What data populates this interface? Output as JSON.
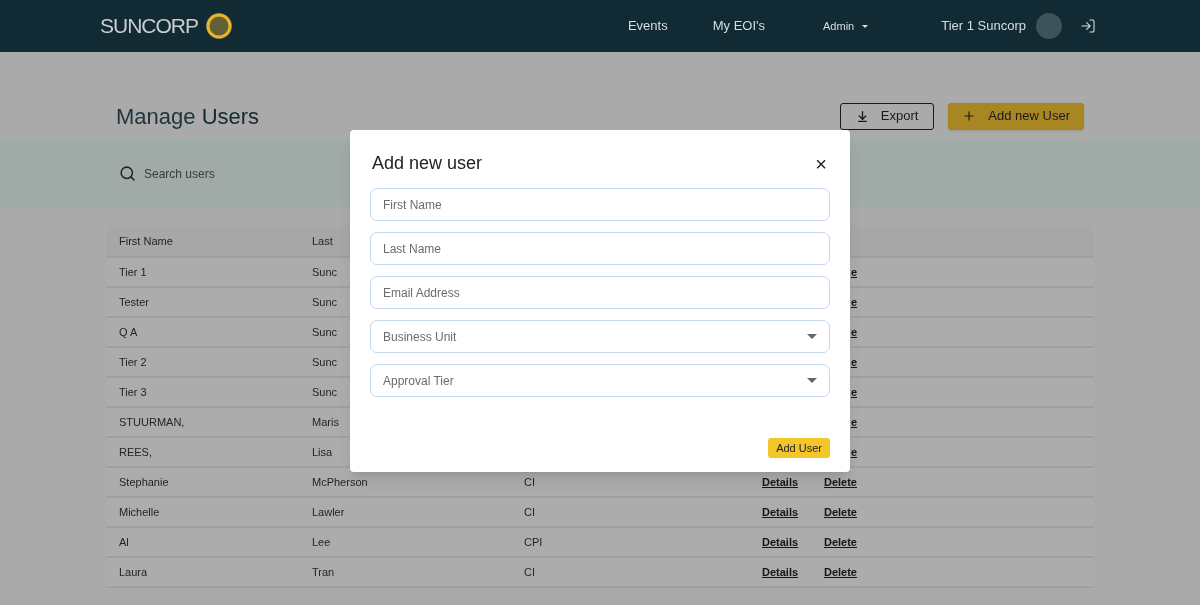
{
  "header": {
    "logo_text": "SUNCORP",
    "nav": [
      {
        "label": "Events",
        "kind": "link"
      },
      {
        "label": "My EOI's",
        "kind": "link"
      },
      {
        "label": "Admin",
        "kind": "dropdown"
      }
    ],
    "user_name": "Tier 1 Suncorp"
  },
  "page": {
    "title_light": "Manage",
    "title_bold": "Users",
    "export_button": "Export",
    "add_button": "Add new User"
  },
  "search": {
    "placeholder": "Search users"
  },
  "table": {
    "columns": [
      "First Name",
      "Last"
    ],
    "rows": [
      {
        "first_name": "Tier 1",
        "last_name": "Sunc",
        "delete": "e"
      },
      {
        "first_name": "Tester",
        "last_name": "Sunc",
        "delete": "e"
      },
      {
        "first_name": "Q A",
        "last_name": "Sunc",
        "delete": "e"
      },
      {
        "first_name": "Tier 2",
        "last_name": "Sunc",
        "delete": "e"
      },
      {
        "first_name": "Tier 3",
        "last_name": "Sunc",
        "delete": "e"
      },
      {
        "first_name": "STUURMAN,",
        "last_name": "Maris",
        "delete": "e"
      },
      {
        "first_name": "REES,",
        "last_name": "Lisa",
        "delete": "e"
      },
      {
        "first_name": "Stephanie",
        "last_name": "McPherson",
        "unit": "CI",
        "details": "Details",
        "delete": "Delete"
      },
      {
        "first_name": "Michelle",
        "last_name": "Lawler",
        "unit": "CI",
        "details": "Details",
        "delete": "Delete"
      },
      {
        "first_name": "Al",
        "last_name": "Lee",
        "unit": "CPI",
        "details": "Details",
        "delete": "Delete"
      },
      {
        "first_name": "Laura",
        "last_name": "Tran",
        "unit": "CI",
        "details": "Details",
        "delete": "Delete"
      }
    ]
  },
  "modal": {
    "title": "Add new user",
    "close": "×",
    "fields": [
      {
        "placeholder": "First Name",
        "kind": "text"
      },
      {
        "placeholder": "Last Name",
        "kind": "text"
      },
      {
        "placeholder": "Email Address",
        "kind": "text"
      },
      {
        "placeholder": "Business Unit",
        "kind": "select"
      },
      {
        "placeholder": "Approval Tier",
        "kind": "select"
      }
    ],
    "submit": "Add User"
  }
}
